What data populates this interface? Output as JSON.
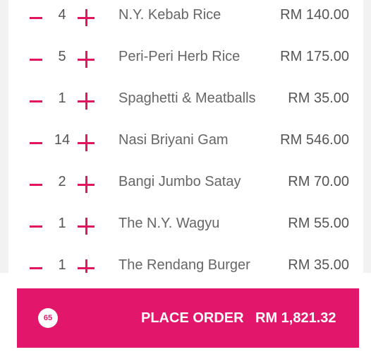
{
  "colors": {
    "accent": "#e2165e",
    "order_bar": "#e2166a",
    "text": "#555555",
    "background": "#ffffff"
  },
  "icons": {
    "decrease": "minus-icon",
    "increase": "plus-icon"
  },
  "items": [
    {
      "qty": "4",
      "name": "N.Y. Kebab Rice",
      "price": "RM 140.00"
    },
    {
      "qty": "5",
      "name": "Peri-Peri Herb Rice",
      "price": "RM 175.00"
    },
    {
      "qty": "1",
      "name": "Spaghetti & Meatballs",
      "price": "RM 35.00"
    },
    {
      "qty": "14",
      "name": "Nasi Briyani Gam",
      "price": "RM 546.00"
    },
    {
      "qty": "2",
      "name": "Bangi Jumbo Satay",
      "price": "RM 70.00"
    },
    {
      "qty": "1",
      "name": "The N.Y. Wagyu",
      "price": "RM 55.00"
    },
    {
      "qty": "1",
      "name": "The Rendang Burger",
      "price": "RM 35.00"
    }
  ],
  "order": {
    "item_count": "65",
    "label": "PLACE ORDER",
    "total": "RM 1,821.32"
  }
}
